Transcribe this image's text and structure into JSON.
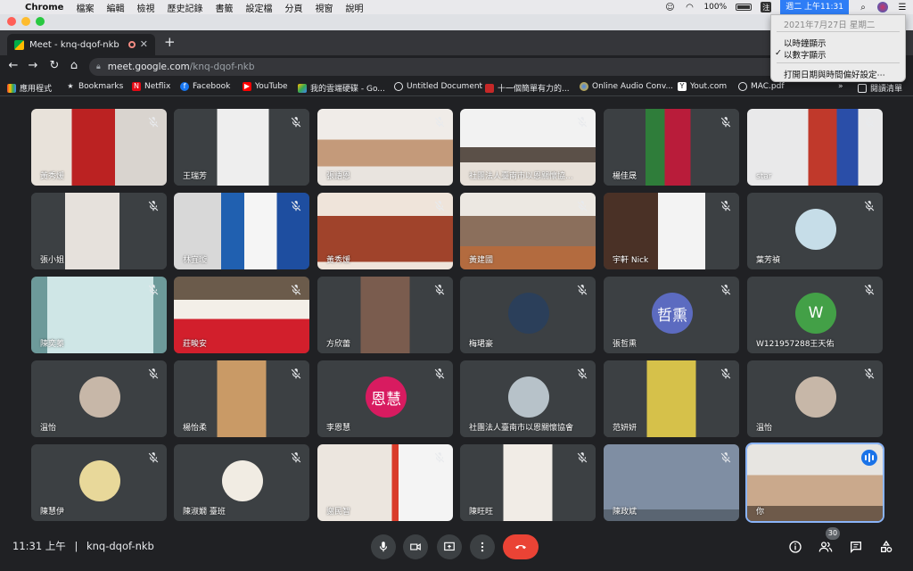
{
  "menubar": {
    "app": "Chrome",
    "items": [
      "檔案",
      "編輯",
      "檢視",
      "歷史記錄",
      "書籤",
      "設定檔",
      "分頁",
      "視窗",
      "說明"
    ],
    "battery": "100%",
    "clock": "週二 上午11:31"
  },
  "clock_menu": {
    "date": "2021年7月27日 星期二",
    "option_analog": "以時鐘顯示",
    "option_digital": "以數字顯示",
    "open_prefs": "打開日期與時間偏好設定⋯"
  },
  "browser": {
    "tab_title": "Meet - knq-dqof-nkb",
    "url_host": "meet.google.com",
    "url_path": "/knq-dqof-nkb",
    "bookmarks": [
      "應用程式",
      "Bookmarks",
      "Netflix",
      "Facebook",
      "YouTube",
      "我的雲端硬碟 - Go...",
      "Untitled Document",
      "十一個簡單有力的...",
      "Online Audio Conv...",
      "Yout.com",
      "MAC.pdf"
    ],
    "reading_list": "閱讀清單",
    "more": "»"
  },
  "participants": [
    {
      "name": "黃秀煖"
    },
    {
      "name": "王瑞芳"
    },
    {
      "name": "張語恩"
    },
    {
      "name": "社團法人臺南市以恩關懷協..."
    },
    {
      "name": "楊佳晟"
    },
    {
      "name": "star"
    },
    {
      "name": "張小姐"
    },
    {
      "name": "林宜璇"
    },
    {
      "name": "黃秀煖"
    },
    {
      "name": "黃建國"
    },
    {
      "name": "宇軒 Nick"
    },
    {
      "name": "葉芳禎"
    },
    {
      "name": "陳奕蓁"
    },
    {
      "name": "莊畯安"
    },
    {
      "name": "方欣蕾"
    },
    {
      "name": "梅珺豪"
    },
    {
      "name": "張哲熏",
      "initials": "哲熏"
    },
    {
      "name": "W121957288王天佑",
      "initials": "W"
    },
    {
      "name": "溫怡"
    },
    {
      "name": "楊怡柔"
    },
    {
      "name": "李恩慧",
      "initials": "恩慧"
    },
    {
      "name": "社團法人臺南市以恩關懷協會"
    },
    {
      "name": "范妍妍"
    },
    {
      "name": "溫怡"
    },
    {
      "name": "陳慧伊"
    },
    {
      "name": "陳淑嫺 臺班"
    },
    {
      "name": "謝民智"
    },
    {
      "name": "陳旺旺"
    },
    {
      "name": "陳政斌"
    },
    {
      "name": "你"
    }
  ],
  "meeting": {
    "time": "11:31 上午",
    "separator": "|",
    "code": "knq-dqof-nkb",
    "participant_count": "30"
  },
  "colors": {
    "accent": "#1a73e8",
    "end_call": "#ea4335",
    "tile_bg": "#3c4043"
  }
}
